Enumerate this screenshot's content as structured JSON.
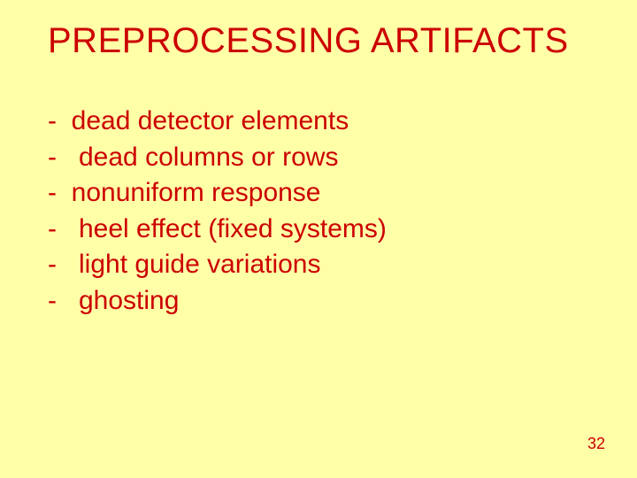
{
  "title": "PREPROCESSING ARTIFACTS",
  "bullets": [
    "-  dead detector elements",
    "-   dead columns or rows",
    "-  nonuniform response",
    "-   heel effect (fixed systems)",
    "-   light guide variations",
    "-   ghosting"
  ],
  "page_number": "32"
}
